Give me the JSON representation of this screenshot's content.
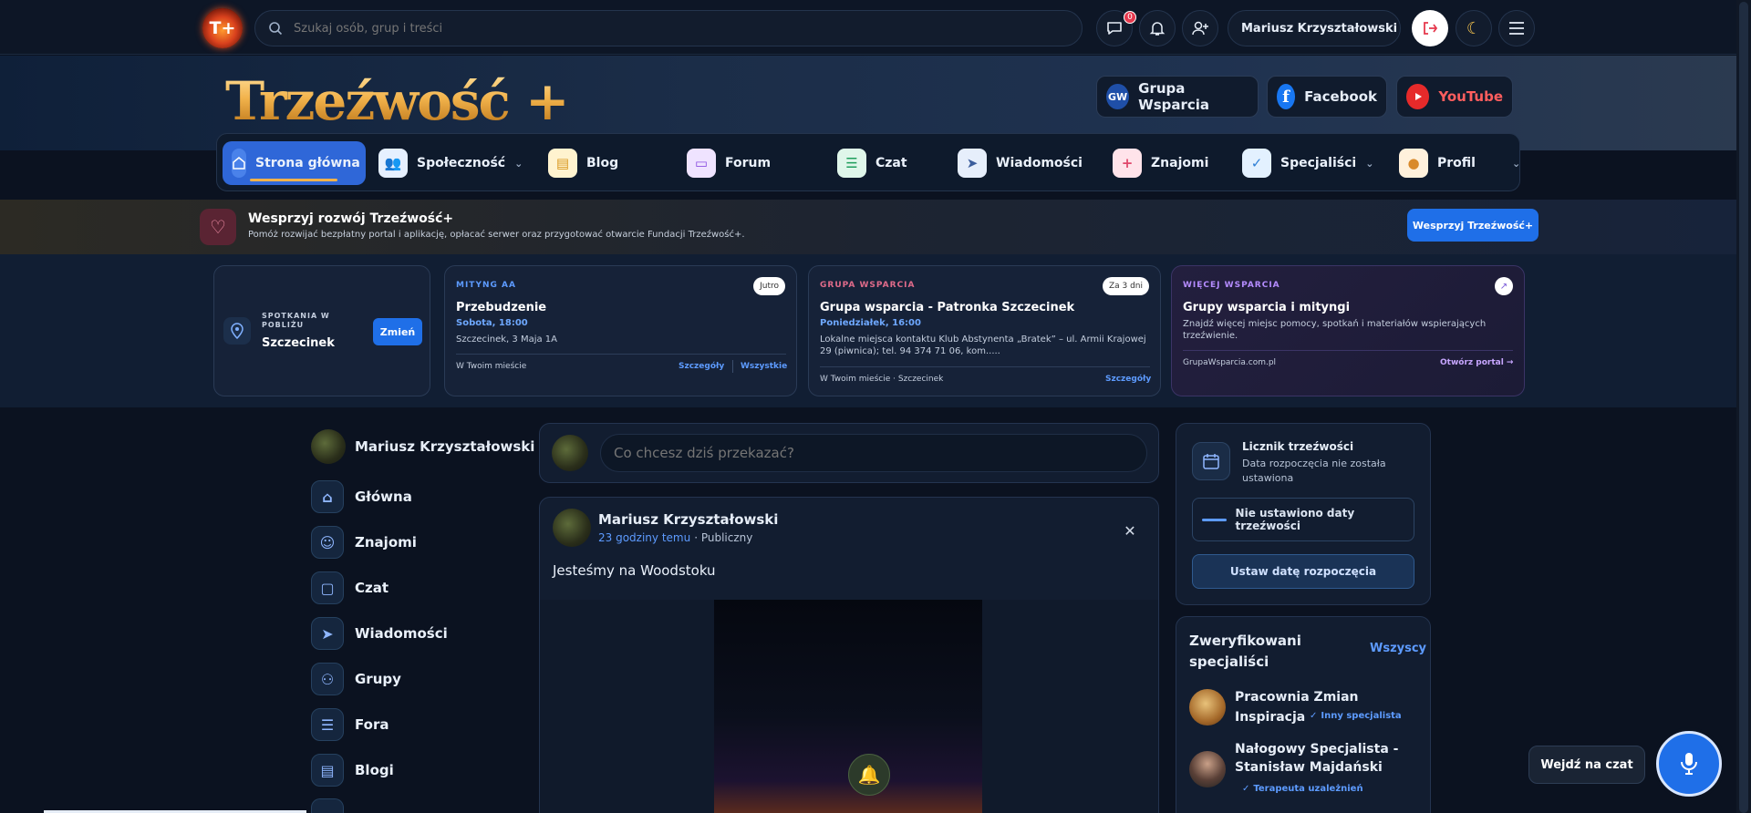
{
  "topbar": {
    "logo_text": "T+",
    "search_placeholder": "Szukaj osób, grup i treści",
    "messages_count": "0",
    "user_name": "Mariusz Krzyształowski"
  },
  "hero": {
    "brand": "Trzeźwość +",
    "links": [
      {
        "icon": "GW",
        "label": "Grupa Wsparcia"
      },
      {
        "icon": "facebook-icon",
        "label": "Facebook"
      },
      {
        "icon": "youtube-icon",
        "label": "YouTube"
      }
    ]
  },
  "nav": {
    "items": [
      {
        "label": "Strona główna",
        "active": true
      },
      {
        "label": "Społeczność",
        "has_dropdown": true
      },
      {
        "label": "Blog"
      },
      {
        "label": "Forum"
      },
      {
        "label": "Czat"
      },
      {
        "label": "Wiadomości"
      },
      {
        "label": "Znajomi"
      },
      {
        "label": "Specjaliści",
        "has_dropdown": true
      },
      {
        "label": "Profil",
        "has_dropdown": true
      }
    ]
  },
  "support": {
    "title": "Wesprzyj rozwój Trzeźwość+",
    "subtitle": "Pomóż rozwijać bezpłatny portal i aplikację, opłacać serwer oraz przygotować otwarcie Fundacji Trzeźwość+.",
    "button": "Wesprzyj Trzeźwość+"
  },
  "location": {
    "label": "SPOTKANIA W POBLIŻU",
    "city": "Szczecinek",
    "change": "Zmień"
  },
  "cards": [
    {
      "category": "MITYNG AA",
      "badge": "Jutro",
      "title": "Przebudzenie",
      "date": "Sobota, 18:00",
      "text": "Szczecinek, 3 Maja 1A",
      "footer": "W Twoim mieście",
      "link1": "Szczegóły",
      "link2": "Wszystkie"
    },
    {
      "category": "GRUPA WSPARCIA",
      "badge": "Za 3 dni",
      "title": "Grupa wsparcia - Patronka Szczecinek",
      "date": "Poniedziałek, 16:00",
      "text": "Lokalne miejsca kontaktu Klub Abstynenta „Bratek” – ul. Armii Krajowej 29 (piwnica); tel. 94 374 71 06, kom.....",
      "footer": "W Twoim mieście · Szczecinek",
      "link1": "Szczegóły"
    },
    {
      "category": "WIĘCEJ WSPARCIA",
      "title": "Grupy wsparcia i mityngi",
      "text": "Znajdź więcej miejsc pomocy, spotkań i materiałów wspierających trzeźwienie.",
      "footer": "GrupaWsparcia.com.pl",
      "link1": "Otwórz portal →"
    }
  ],
  "sidebar": {
    "user": "Mariusz Krzyształowski",
    "items": [
      "Główna",
      "Znajomi",
      "Czat",
      "Wiadomości",
      "Grupy",
      "Fora",
      "Blogi"
    ]
  },
  "composer": {
    "placeholder": "Co chcesz dziś przekazać?"
  },
  "post": {
    "author": "Mariusz Krzyształowski",
    "time": "23 godziny temu",
    "visibility": "· Publiczny",
    "text": "Jesteśmy na Woodstoku"
  },
  "sobriety": {
    "title": "Licznik trzeźwości",
    "subtitle": "Data rozpoczęcia nie została ustawiona",
    "status": "Nie ustawiono daty trzeźwości",
    "button": "Ustaw datę rozpoczęcia"
  },
  "specialists": {
    "title": "Zweryfikowani specjaliści",
    "all": "Wszyscy",
    "items": [
      {
        "name": "Pracownia Zmian Inspiracja",
        "role": "Inny specjalista"
      },
      {
        "name": "Nałogowy Specjalista - Stanisław Majdański",
        "role": "Terapeuta uzależnień"
      }
    ]
  },
  "chat_cta": "Wejdź na czat"
}
